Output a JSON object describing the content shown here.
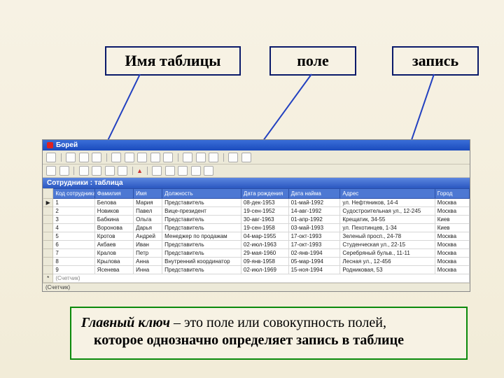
{
  "labels": {
    "table_name": "Имя таблицы",
    "field": "поле",
    "record": "запись"
  },
  "db": {
    "title": "Борей",
    "subtitle": "Сотрудники : таблица",
    "navigator": "(Счетчик)",
    "columns": {
      "id": "Код сотрудника",
      "lastname": "Фамилия",
      "firstname": "Имя",
      "position": "Должность",
      "birthdate": "Дата рождения",
      "hiredate": "Дата найма",
      "address": "Адрес",
      "city": "Город"
    },
    "rows": [
      {
        "id": "1",
        "lastname": "Белова",
        "firstname": "Мария",
        "position": "Представитель",
        "birthdate": "08-дек-1953",
        "hiredate": "01-май-1992",
        "address": "ул. Нефтяников, 14-4",
        "city": "Москва"
      },
      {
        "id": "2",
        "lastname": "Новиков",
        "firstname": "Павел",
        "position": "Вице-президент",
        "birthdate": "19-сен-1952",
        "hiredate": "14-авг-1992",
        "address": "Судостроительная ул., 12-245",
        "city": "Москва"
      },
      {
        "id": "3",
        "lastname": "Бабкина",
        "firstname": "Ольга",
        "position": "Представитель",
        "birthdate": "30-авг-1963",
        "hiredate": "01-апр-1992",
        "address": "Крещатик, 34-55",
        "city": "Киев"
      },
      {
        "id": "4",
        "lastname": "Воронова",
        "firstname": "Дарья",
        "position": "Представитель",
        "birthdate": "19-сен-1958",
        "hiredate": "03-май-1993",
        "address": "ул. Пехотинцев, 1-34",
        "city": "Киев"
      },
      {
        "id": "5",
        "lastname": "Кротов",
        "firstname": "Андрей",
        "position": "Менеджер по продажам",
        "birthdate": "04-мар-1955",
        "hiredate": "17-окт-1993",
        "address": "Зеленый просп., 24-78",
        "city": "Москва"
      },
      {
        "id": "6",
        "lastname": "Акбаев",
        "firstname": "Иван",
        "position": "Представитель",
        "birthdate": "02-июл-1963",
        "hiredate": "17-окт-1993",
        "address": "Студенческая ул., 22-15",
        "city": "Москва"
      },
      {
        "id": "7",
        "lastname": "Кралов",
        "firstname": "Петр",
        "position": "Представитель",
        "birthdate": "29-мая-1960",
        "hiredate": "02-янв-1994",
        "address": "Серебряный бульв., 11-11",
        "city": "Москва"
      },
      {
        "id": "8",
        "lastname": "Крылова",
        "firstname": "Анна",
        "position": "Внутренний координатор",
        "birthdate": "09-янв-1958",
        "hiredate": "05-мар-1994",
        "address": "Лесная ул., 12-456",
        "city": "Москва"
      },
      {
        "id": "9",
        "lastname": "Ясенева",
        "firstname": "Инна",
        "position": "Представитель",
        "birthdate": "02-июл-1969",
        "hiredate": "15-ноя-1994",
        "address": "Родниковая, 53",
        "city": "Москва"
      }
    ]
  },
  "definition": {
    "key_term": "Главный ключ",
    "dash": " – ",
    "rest1": "это поле или совокупность полей,",
    "line2": "которое однозначно определяет запись в таблице"
  }
}
